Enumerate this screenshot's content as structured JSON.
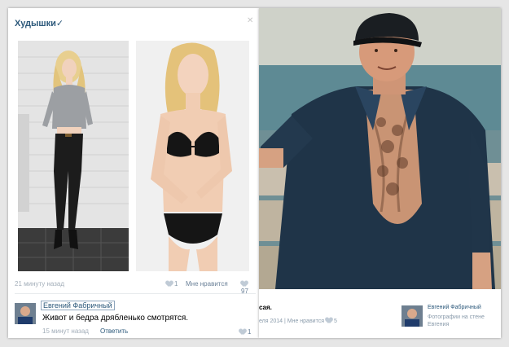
{
  "left_post": {
    "group_title": "Худышки",
    "verified_mark": "✓",
    "close_label": "✕",
    "time": "21 минуту назад",
    "share_count": "1",
    "like_label": "Мне нравится",
    "like_count": "97",
    "comment": {
      "author": "Евгений Фабричный",
      "text": "Живот и бедра дрябленько смотрятся.",
      "time": "15 минут назад",
      "reply_label": "Ответить",
      "like_count": "1"
    }
  },
  "right_post": {
    "caption": "сая.",
    "date_line": "еля 2014 | Мне нравится",
    "like_count": "5",
    "author": "Евгений Фабричный",
    "photo_desc": "Фотографии на стене Евгения"
  },
  "colors": {
    "link": "#2b587a",
    "meta": "#a3aeb9",
    "card_bg": "#ffffff"
  }
}
